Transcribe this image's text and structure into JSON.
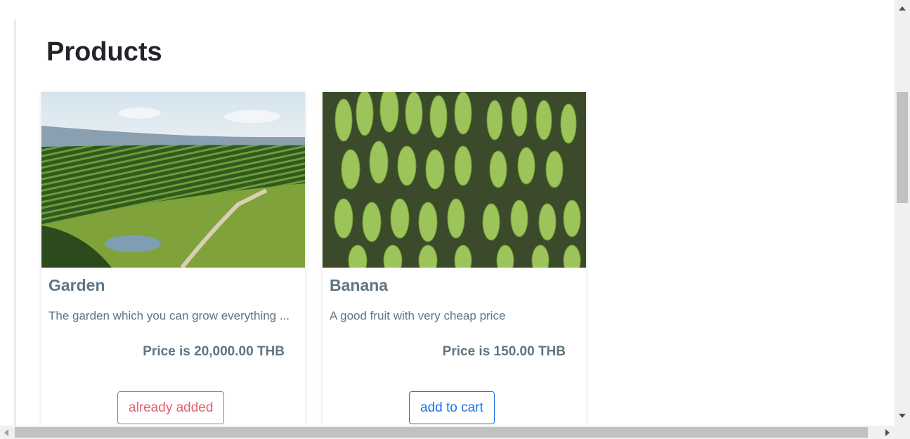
{
  "page": {
    "title": "Products"
  },
  "products": [
    {
      "name": "Garden",
      "description": "The garden which you can grow everything ...",
      "price_text": "Price is 20,000.00 THB",
      "button_label": "already added",
      "image": "garden-photo"
    },
    {
      "name": "Banana",
      "description": "A good fruit with very cheap price",
      "price_text": "Price is 150.00 THB",
      "button_label": "add to cart",
      "image": "banana-photo"
    }
  ],
  "colors": {
    "title": "#212529",
    "card_text": "#5f7585",
    "added_button": "#e4606d",
    "cart_button": "#1a73e8"
  }
}
